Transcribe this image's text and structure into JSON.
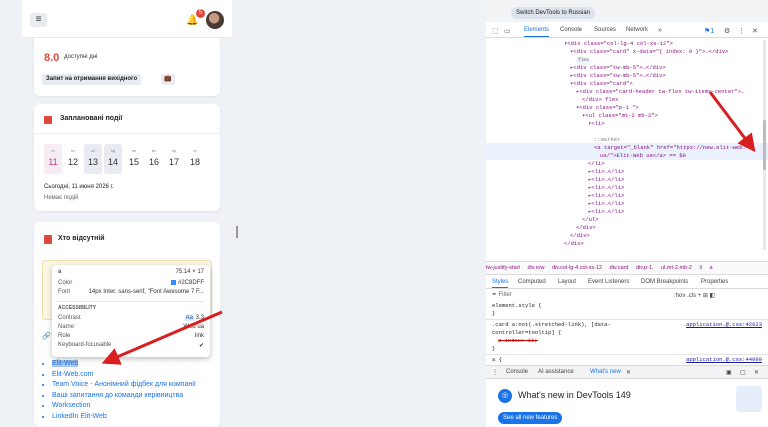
{
  "app": {
    "notif_count": "5",
    "leave": {
      "days": "8.0",
      "days_label": "доступні дні",
      "request_label": "Запит на отримання вихідного"
    },
    "events": {
      "title": "Заплановані події",
      "week": [
        {
          "name": "чт",
          "day": "11",
          "state": "today"
        },
        {
          "name": "пт",
          "day": "12",
          "state": ""
        },
        {
          "name": "сб",
          "day": "13",
          "state": "weekend"
        },
        {
          "name": "нд",
          "day": "14",
          "state": "weekend"
        },
        {
          "name": "пн",
          "day": "15",
          "state": ""
        },
        {
          "name": "вт",
          "day": "16",
          "state": ""
        },
        {
          "name": "ср",
          "day": "17",
          "state": ""
        },
        {
          "name": "чт",
          "day": "18",
          "state": ""
        }
      ],
      "today_label": "Сьогодні, 11 июня 2026 г.",
      "no_events": "Немає подій"
    },
    "absent": {
      "title": "Хто відсутній"
    },
    "links": [
      "Elit-Web",
      "Elit-Web.com",
      "Team Voice - Анонімний фідбек для компанії",
      "Ваші запитання до команди керівництва",
      "Worksection",
      "LinkedIn Elit-Web"
    ]
  },
  "tooltip": {
    "tag": "a",
    "size": "75.14 × 17",
    "color_label": "Color",
    "color_value": "#2C8DFF",
    "font_label": "Font",
    "font_value": "14px Inter, sans-serif, \"Font Awesome 7 F...",
    "section": "ACCESSIBILITY",
    "contrast_label": "Contrast",
    "contrast_value": "3.3",
    "name_label": "Name",
    "name_value": "Web ua",
    "role_label": "Role",
    "role_value": "link",
    "focus_label": "Keyboard-focusable"
  },
  "devtools": {
    "switch_label": "Switch DevTools to Russian",
    "tabs": [
      "Elements",
      "Console",
      "Sources",
      "Network"
    ],
    "issues_count": "1",
    "dom_lines": [
      {
        "indent": 78,
        "html": "▾<div class=\"col-lg-4 col-xs-12\">"
      },
      {
        "indent": 84,
        "html": "▾<div class=\"card\" x-data=\"{ index: 0 }\">…</div>"
      },
      {
        "indent": 90,
        "html": "flex"
      },
      {
        "indent": 84,
        "html": "▸<div class=\"tw-mb-5\">…</div>"
      },
      {
        "indent": 84,
        "html": "▸<div class=\"tw-mb-5\">…</div>"
      },
      {
        "indent": 84,
        "html": "▾<div class=\"card\">"
      },
      {
        "indent": 90,
        "html": "▸<div class=\"card-header tw-flex tw-items-center\">…"
      },
      {
        "indent": 96,
        "html": "</div> flex"
      },
      {
        "indent": 90,
        "html": "▾<div class=\"p-1 \">"
      },
      {
        "indent": 96,
        "html": "▾<ul class=\"mt-2 mb-2\">"
      },
      {
        "indent": 102,
        "html": "▾<li>"
      },
      {
        "indent": 108,
        "html": "::marker"
      },
      {
        "indent": 108,
        "html": "<a target=\"_blank\" href=\"https://new.elit-web."
      },
      {
        "indent": 114,
        "html": "ua/\">Elit-Web ua</a> == $0"
      },
      {
        "indent": 102,
        "html": "</li>"
      },
      {
        "indent": 102,
        "html": "▸<li>…</li>"
      },
      {
        "indent": 102,
        "html": "▸<li>…</li>"
      },
      {
        "indent": 102,
        "html": "▸<li>…</li>"
      },
      {
        "indent": 102,
        "html": "▸<li>…</li>"
      },
      {
        "indent": 102,
        "html": "▸<li>…</li>"
      },
      {
        "indent": 102,
        "html": "▸<li>…</li>"
      },
      {
        "indent": 96,
        "html": "</ul>"
      },
      {
        "indent": 90,
        "html": "</div>"
      },
      {
        "indent": 84,
        "html": "</div>"
      },
      {
        "indent": 78,
        "html": "</div>"
      }
    ],
    "breadcrumbs": [
      "tw-justify-start",
      "div.row",
      "div.col-lg-4.col-xs-12",
      "div.card",
      "div.p-1.",
      "ul.mt-2.mb-2",
      "li",
      "a"
    ],
    "style_tabs": [
      "Styles",
      "Computed",
      "Layout",
      "Event Listeners",
      "DOM Breakpoints",
      "Properties"
    ],
    "filter_placeholder": "Filter",
    "filter_tools": ":hov .cls + ⊞ ◧",
    "rules": {
      "element_style": "element.style {",
      "close1": "}",
      "rule2_selector": ".card a:not(.stretched-link), [data-",
      "rule2_selector_b": "controller=tooltip] {",
      "rule2_src": "application.@.css:42623",
      "rule2_prop": "z-index: 11;",
      "close2": "}",
      "rule3_selector": "a {",
      "rule3_src": "application.@.css:44090"
    },
    "drawer_tabs": [
      "Console",
      "AI assistance",
      "What's new"
    ],
    "whats_new_title": "What's new in DevTools 149",
    "whats_new_button": "See all new features"
  },
  "colors": {
    "accent": "#1a73e8",
    "danger": "#e0483e",
    "tooltip_color": "#2c8dff",
    "arrow": "#d81e1e"
  }
}
